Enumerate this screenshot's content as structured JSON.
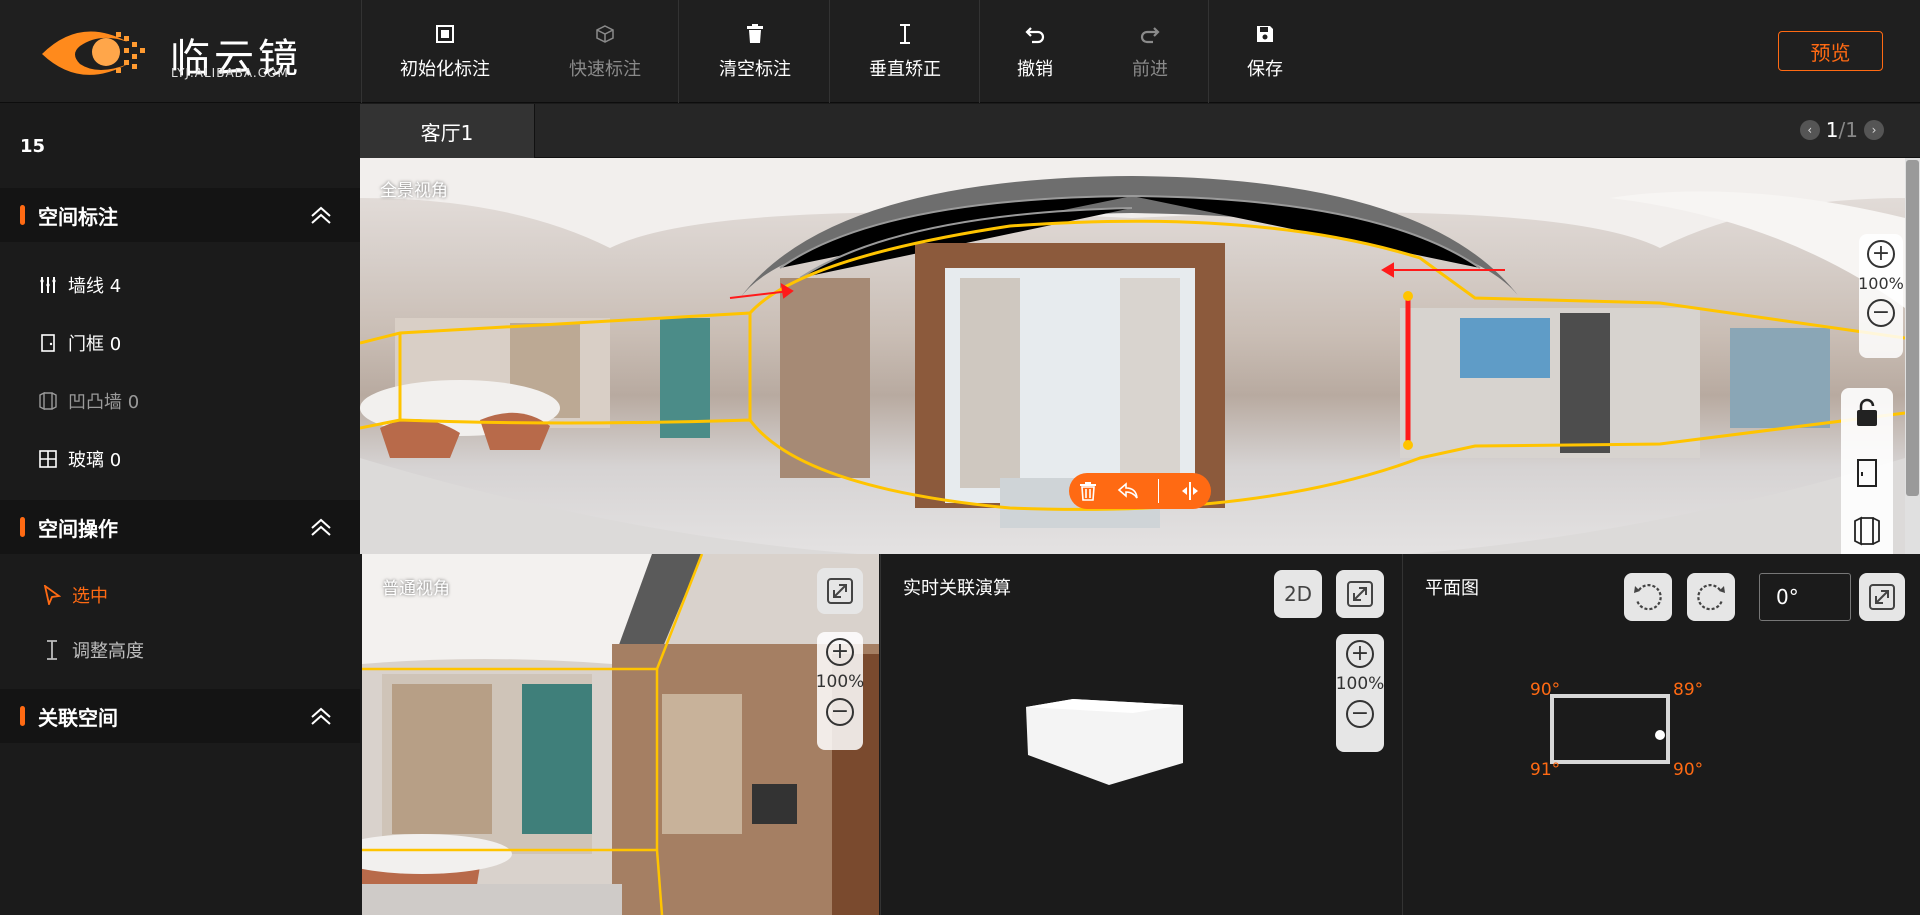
{
  "app": {
    "logo_text": "临云镜",
    "logo_sub": "LYJ.ALIBABA.COM"
  },
  "toolbar": {
    "init_label": "初始化标注",
    "quick_label": "快速标注",
    "clear_label": "清空标注",
    "vertical_label": "垂直矫正",
    "undo_label": "撤销",
    "redo_label": "前进",
    "save_label": "保存",
    "preview_label": "预览"
  },
  "sidebar": {
    "count": "15",
    "sections": [
      {
        "title": "空间标注"
      },
      {
        "title": "空间操作"
      },
      {
        "title": "关联空间"
      }
    ],
    "annotation_items": [
      {
        "label": "墙线 4",
        "icon": "wall-line-icon"
      },
      {
        "label": "门框 0",
        "icon": "door-frame-icon"
      },
      {
        "label": "凹凸墙 0",
        "icon": "concave-wall-icon"
      },
      {
        "label": "玻璃 0",
        "icon": "glass-icon"
      }
    ],
    "operation_items": [
      {
        "label": "选中",
        "icon": "cursor-icon",
        "active": true
      },
      {
        "label": "调整高度",
        "icon": "height-adjust-icon"
      }
    ]
  },
  "tabs": {
    "room": "客厅1",
    "page_current": "1",
    "page_total": "/1"
  },
  "pano": {
    "label": "全景视角",
    "zoom": "100%"
  },
  "normal_view": {
    "label": "普通视角",
    "zoom": "100%"
  },
  "realtime": {
    "title": "实时关联演算",
    "mode_2d": "2D",
    "zoom": "100%"
  },
  "floorplan": {
    "title": "平面图",
    "angle": "0°",
    "corners": {
      "top_left": "90°",
      "top_right": "89°",
      "bottom_left": "91°",
      "bottom_right": "90°"
    }
  },
  "colors": {
    "accent": "#ff6a13",
    "annotation": "#ffc400",
    "marker": "#ff1a1a"
  }
}
